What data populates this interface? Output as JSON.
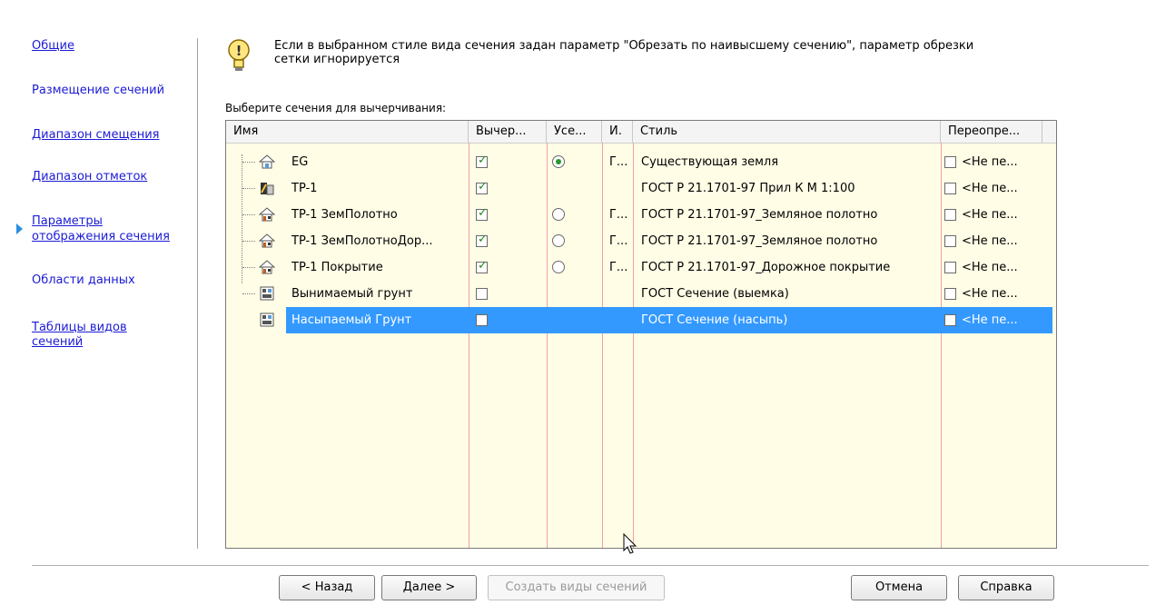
{
  "nav": {
    "items": [
      {
        "label": "Общие",
        "active": false
      },
      {
        "label": "Размещение сечений",
        "active": false
      },
      {
        "label": "Диапазон смещения",
        "active": false
      },
      {
        "label": "Диапазон отметок",
        "active": false
      },
      {
        "label": "Параметры отображения сечения",
        "line1": "Параметры",
        "line2": "отображения сечения",
        "active": true
      },
      {
        "label": "Области данных",
        "active": false
      },
      {
        "label": "Таблицы видов сечений",
        "line1": "Таблицы видов",
        "line2": "сечений",
        "active": false
      }
    ]
  },
  "info": {
    "icon": "lightbulb-icon",
    "line1": "Если в выбранном стиле вида сечения задан параметр \"Обрезать по наивысшему сечению\", параметр обрезки",
    "line2": "сетки игнорируется"
  },
  "grid": {
    "label": "Выберите сечения для вычерчивания:",
    "columns": [
      "Имя",
      "Вычер...",
      "Усе...",
      "И.",
      "Стиль",
      "Переопре..."
    ],
    "rows": [
      {
        "name": "EG",
        "icon": "surface-icon",
        "draw": true,
        "radio": "on",
        "i": "Г...",
        "style": "Существующая земля",
        "override": "<Не пе..."
      },
      {
        "name": "TP-1",
        "icon": "alignment-icon",
        "draw": true,
        "radio": "",
        "i": "",
        "style": "ГОСТ Р 21.1701-97 Прил К  М 1:100",
        "override": "<Не пе..."
      },
      {
        "name": "TP-1 ЗемПолотно",
        "icon": "surface-tp-icon",
        "draw": true,
        "radio": "off",
        "i": "Г...",
        "style": "ГОСТ Р 21.1701-97_Земляное полотно",
        "override": "<Не пе..."
      },
      {
        "name": "TP-1 ЗемПолотноДор...",
        "icon": "surface-tp-icon",
        "draw": true,
        "radio": "off",
        "i": "Г...",
        "style": "ГОСТ Р 21.1701-97_Земляное полотно",
        "override": "<Не пе..."
      },
      {
        "name": "TP-1 Покрытие",
        "icon": "surface-tp-icon",
        "draw": true,
        "radio": "off",
        "i": "Г...",
        "style": "ГОСТ Р 21.1701-97_Дорожное покрытие",
        "override": "<Не пе..."
      },
      {
        "name": "Вынимаемый грунт",
        "icon": "material-icon",
        "draw": false,
        "radio": "",
        "i": "",
        "style": "ГОСТ Сечение (выемка)",
        "override": "<Не пе..."
      },
      {
        "name": "Насыпаемый Грунт",
        "icon": "material-icon",
        "draw": false,
        "radio": "",
        "i": "",
        "style": "ГОСТ Сечение (насыпь)",
        "override": "<Не пе...",
        "selected": true
      }
    ]
  },
  "buttons": {
    "back": "< Назад",
    "next": "Далее >",
    "create": "Создать виды сечений",
    "cancel": "Отмена",
    "help": "Справка"
  },
  "colors": {
    "link": "#1b1bd6",
    "selection": "#3399ff",
    "grid_bg": "#fffde6",
    "column_line": "#f0a0a8"
  }
}
